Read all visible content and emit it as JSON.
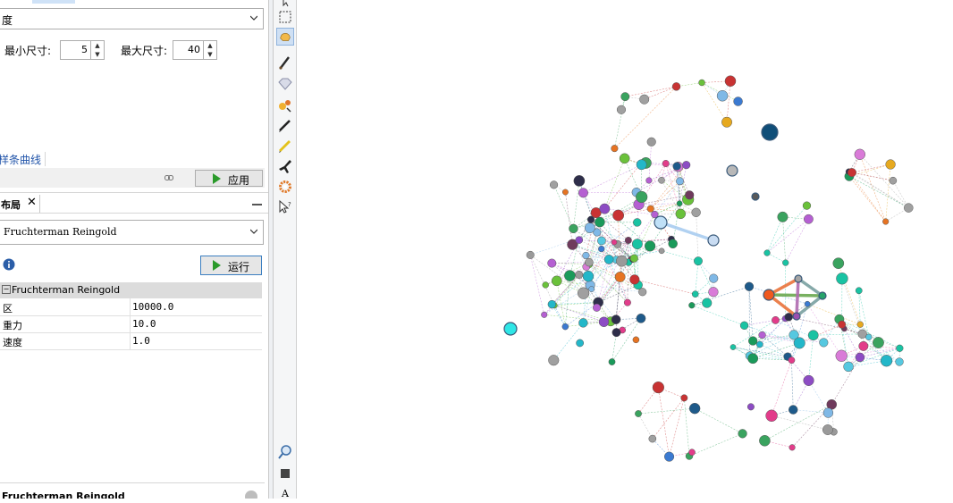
{
  "left_panel": {
    "top_tabs": [
      "…",
      ""
    ],
    "ranking_dropdown": "度",
    "min_size_label": "最小尺寸:",
    "min_size_value": "5",
    "max_size_label": "最大尺寸:",
    "max_size_value": "40",
    "spline_link": "样条曲线",
    "apply_button": "应用",
    "layout_tab": "布局",
    "layout_dropdown": "Fruchterman Reingold",
    "run_button": "运行",
    "properties_header": "Fruchterman Reingold",
    "properties": [
      {
        "key": "区",
        "value": "10000.0"
      },
      {
        "key": "重力",
        "value": "10.0"
      },
      {
        "key": "速度",
        "value": "1.0"
      }
    ],
    "footer_title": "Fruchterman Reingold"
  },
  "toolbar": {
    "tools": [
      "cursor-icon",
      "rect-select-icon",
      "drag-hand-icon",
      "brush-icon",
      "diamond-icon",
      "size-tool-icon",
      "pencil-icon",
      "edge-pencil-icon",
      "airplane-icon",
      "gear-icon",
      "cursor-help-icon"
    ],
    "bottom_tools": [
      "zoom-icon",
      "square-icon",
      "text-icon"
    ],
    "bottom_text_glyph": "A"
  },
  "graph": {
    "highlight_node_color": "#f0591f",
    "highlight_edges": [
      "#e9743b",
      "#6aa84f",
      "#7aa0a0"
    ]
  }
}
